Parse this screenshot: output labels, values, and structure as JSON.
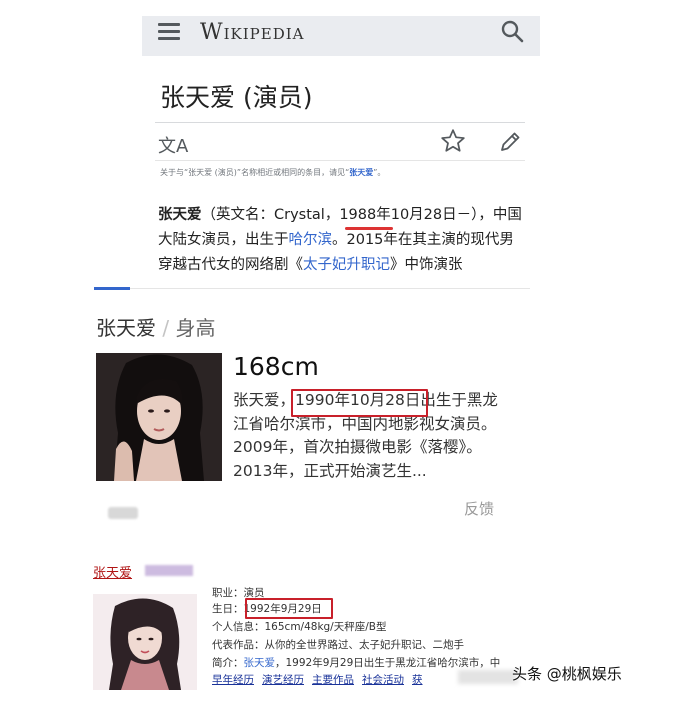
{
  "wiki": {
    "logo": "Wikipedia",
    "title": "张天爱 (演员)",
    "lang_icon": "文A",
    "hatnote_prefix": "关于与“张天爱 (演员)”名称相近或相同的条目，请见“",
    "hatnote_link": "张天爱",
    "hatnote_suffix": "”。",
    "para_bold": "张天爱",
    "para_1": "（英文名：Crystal，1988年10月28日－），中国大陆女演员，出生于",
    "para_link1": "哈尔滨",
    "para_2": "。2015年在其主演的现代男穿越古代女的网络剧《",
    "para_link2": "太子妃升职记",
    "para_3": "》中饰演张"
  },
  "card": {
    "name": "张天爱",
    "separator": "/",
    "attribute": "身高",
    "value": "168cm",
    "desc_1": "张天爱，",
    "desc_date": "1990年10月28日",
    "desc_2": "出生于黑龙江省哈尔滨市，中国内地影视女演员。2009年，首次拍摄微电影《落樱》。2013年，正式开始演艺生...",
    "feedback": "反馈"
  },
  "baike": {
    "name": "张天爱",
    "occupation_label": "职业：",
    "occupation": "演员",
    "birthday_label": "生日：",
    "birthday": "1992年9月29日",
    "personal_label": "个人信息：",
    "personal": "165cm/48kg/天秤座/B型",
    "works_label": "代表作品：",
    "works": "从你的全世界路过、太子妃升职记、二炮手",
    "intro_label": "简介：",
    "intro_link": "张天爱",
    "intro": "，1992年9月29日出生于黑龙江省哈尔滨市，中",
    "links": [
      "早年经历",
      "演艺经历",
      "主要作品",
      "社会活动",
      "获"
    ]
  },
  "watermark": "头条 @桃枫娱乐",
  "colors": {
    "link": "#3366cc",
    "highlight_box": "#c8202a",
    "header_bg": "#eaecf0"
  }
}
